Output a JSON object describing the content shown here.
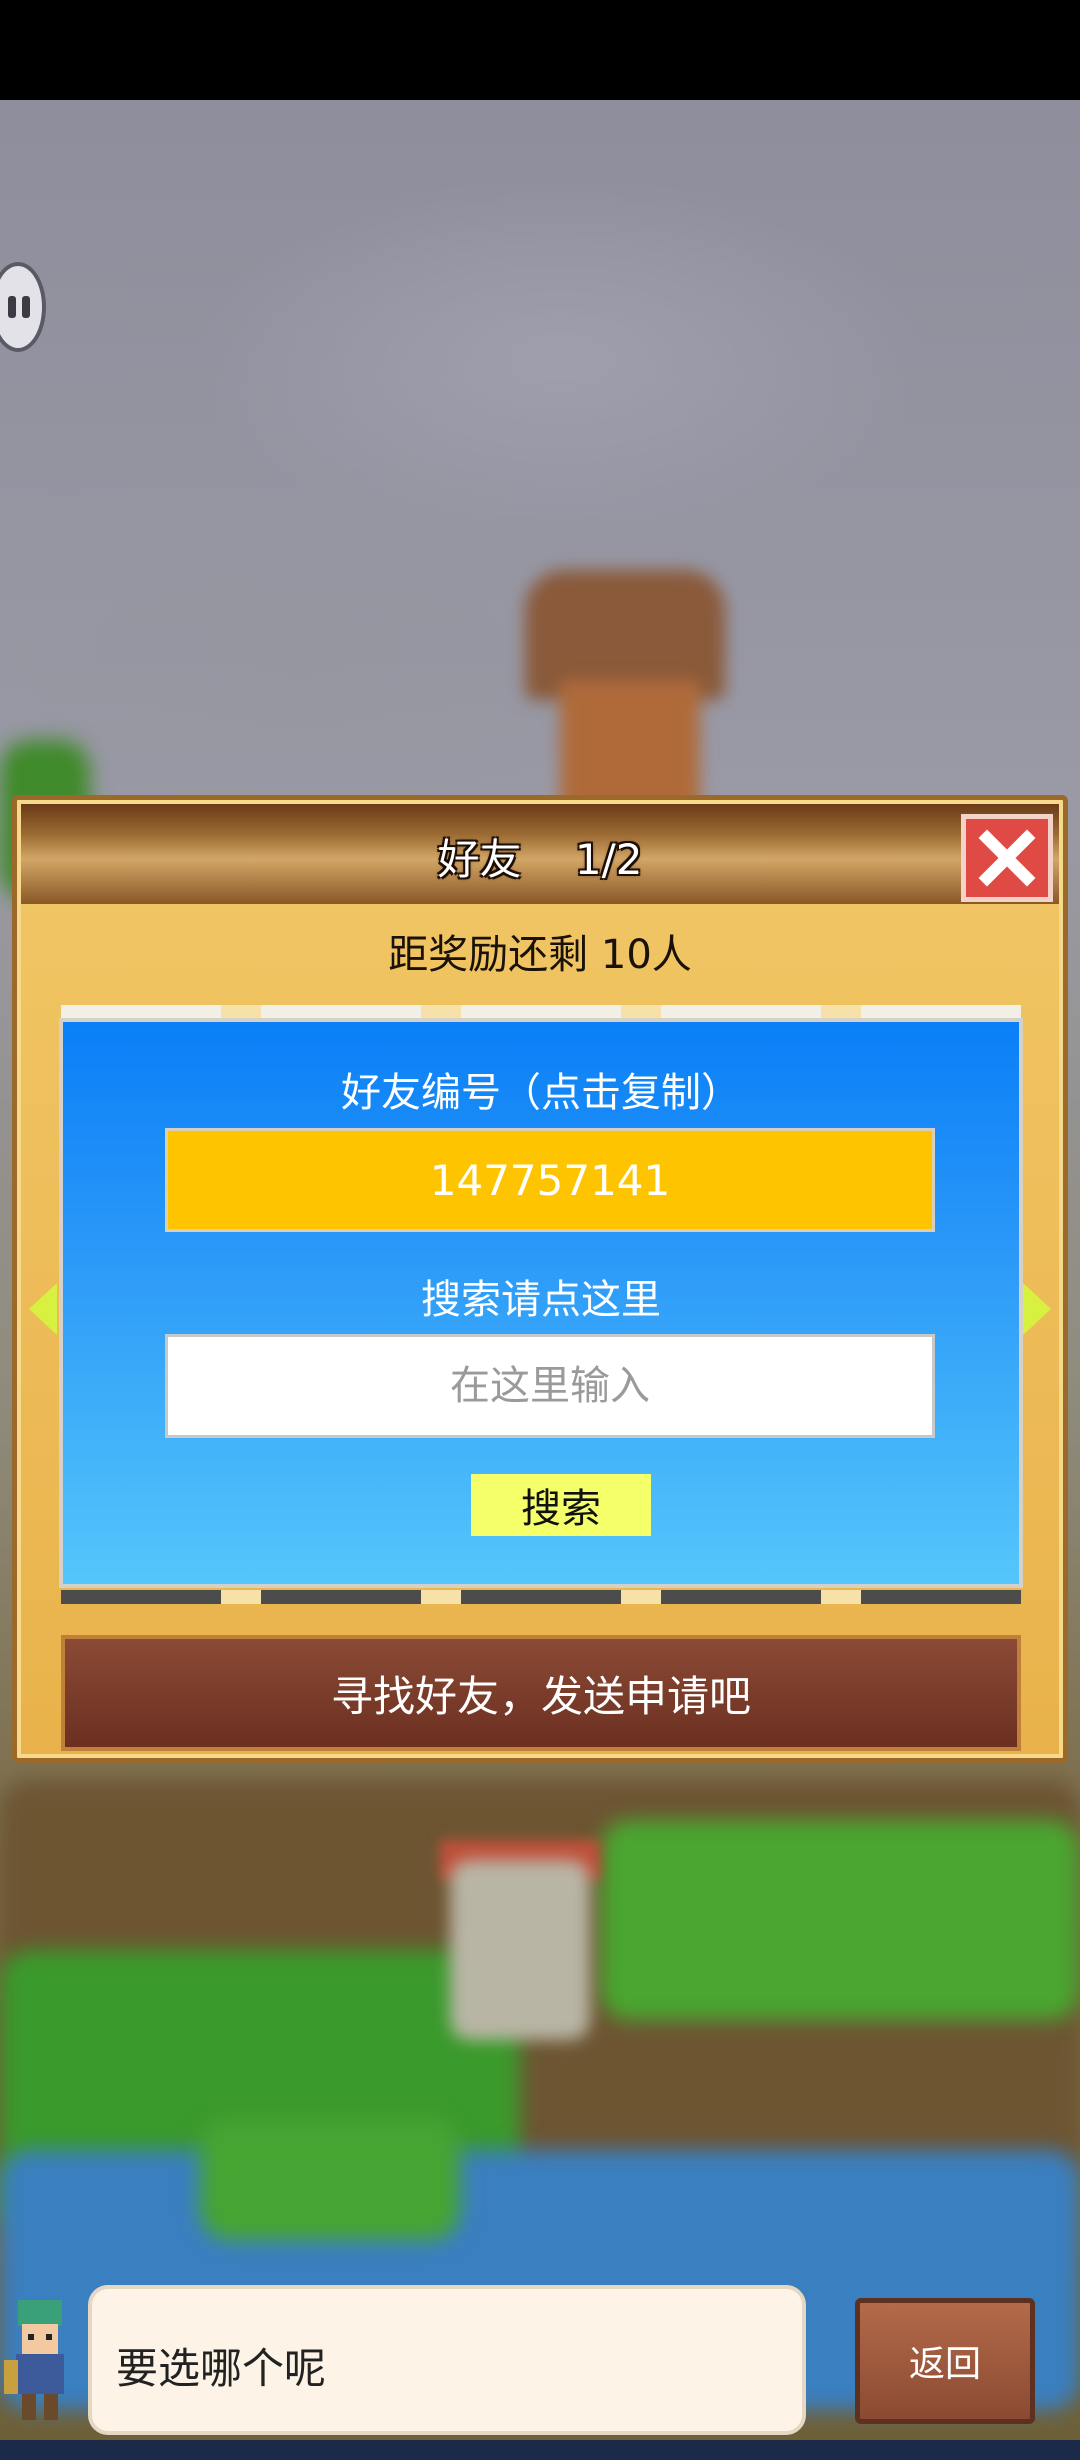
{
  "panel": {
    "title": "好友",
    "page": "1/2",
    "reward_text": "距奖励还剩 10人",
    "friend_id_label": "好友编号（点击复制）",
    "friend_id": "147757141",
    "search_label": "搜索请点这里",
    "search_placeholder": "在这里输入",
    "search_button": "搜索",
    "find_banner": "寻找好友，发送申请吧"
  },
  "footer": {
    "dialog_text": "要选哪个呢",
    "back_button": "返回"
  },
  "colors": {
    "panel_bg": "#e9b24b",
    "blue_box": "#2a98f8",
    "id_field": "#ffc400",
    "search_button": "#f4ff6a",
    "close_button": "#e04a44"
  },
  "icons": [
    "pause-icon",
    "close-icon",
    "left-arrow-icon",
    "right-arrow-icon"
  ]
}
